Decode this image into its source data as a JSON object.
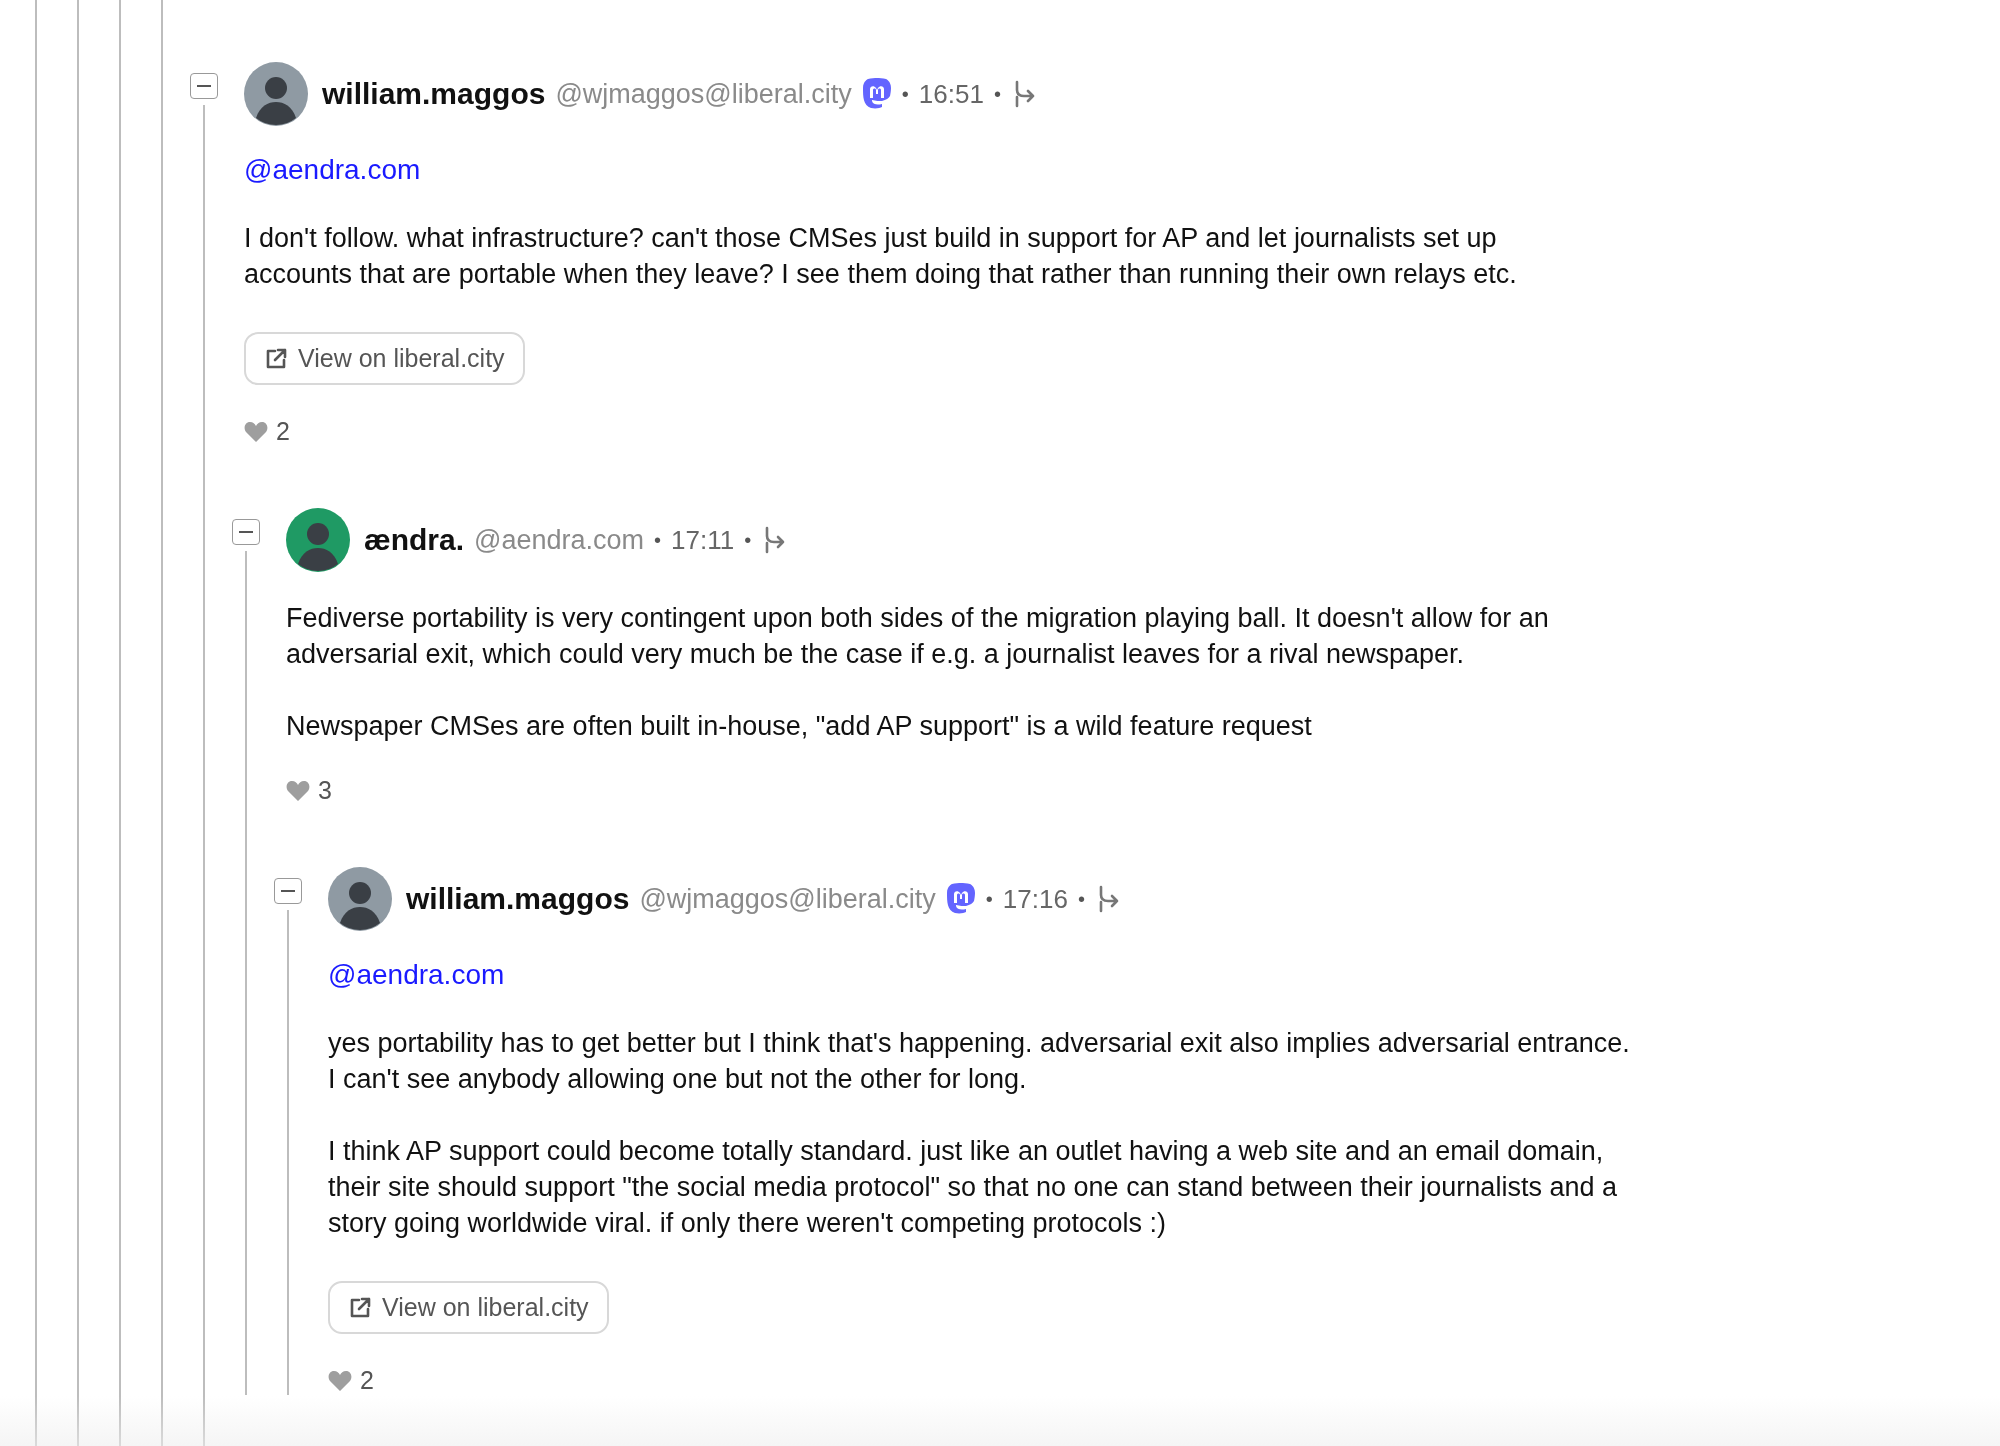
{
  "separator": "•",
  "comments": [
    {
      "author": "william.maggos",
      "handle": "@wjmaggos@liberal.city",
      "fediverse": true,
      "color": "#8f9aa3",
      "time": "16:51",
      "expanded": true,
      "mention": "@aendra.com",
      "paragraphs": [
        "I don't follow. what infrastructure? can't those CMSes just build in support for AP and let journalists set up\naccounts that are portable when they leave? I see them doing that rather than running their own relays etc."
      ],
      "link": "View on liberal.city",
      "likes": "2",
      "children": [
        {
          "author": "ændra.",
          "handle": "@aendra.com",
          "fediverse": false,
          "color": "#1f9a64",
          "time": "17:11",
          "expanded": true,
          "paragraphs": [
            "Fediverse portability is very contingent upon both sides of the migration playing ball. It doesn't allow for an\nadversarial exit, which could very much be the case if e.g. a journalist leaves for a rival newspaper.",
            "Newspaper CMSes are often built in-house, \"add AP support\" is a wild feature request"
          ],
          "likes": "3",
          "children": [
            {
              "author": "william.maggos",
              "handle": "@wjmaggos@liberal.city",
              "fediverse": true,
              "color": "#8f9aa3",
              "time": "17:16",
              "expanded": true,
              "mention": "@aendra.com",
              "paragraphs": [
                "yes portability has to get better but I think that's happening. adversarial exit also implies adversarial entrance.\nI can't see anybody allowing one but not the other for long.",
                "I think AP support could become totally standard. just like an outlet having a web site and an email domain,\ntheir site should support \"the social media protocol\" so that no one can stand between their journalists and a\nstory going worldwide viral. if only there weren't competing protocols :)"
              ],
              "link": "View on liberal.city",
              "likes": "2"
            }
          ]
        }
      ]
    }
  ]
}
